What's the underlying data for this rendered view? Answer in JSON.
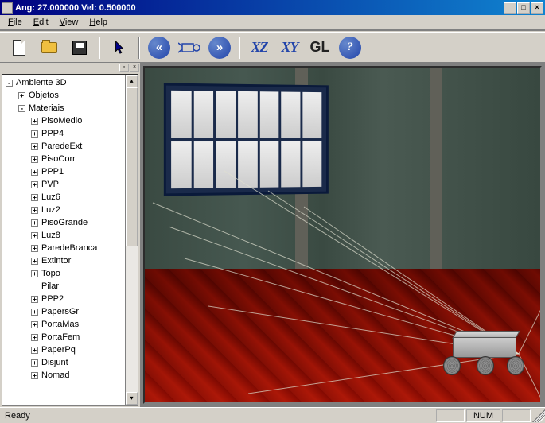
{
  "window": {
    "title": "Ang: 27.000000 Vel: 0.500000",
    "min": "_",
    "max": "□",
    "close": "×"
  },
  "menu": {
    "file": "File",
    "edit": "Edit",
    "view": "View",
    "help": "Help"
  },
  "toolbar": {
    "new": "new-file",
    "open": "open-file",
    "save": "save-file",
    "pointer": "pointer",
    "rewind": "«",
    "camera": "cam",
    "forward": "»",
    "xz": "XZ",
    "xy": "XY",
    "gl": "GL",
    "help": "?"
  },
  "tree": {
    "root": "Ambiente 3D",
    "objetos": "Objetos",
    "materiais": "Materiais",
    "items": [
      "PisoMedio",
      "PPP4",
      "ParedeExt",
      "PisoCorr",
      "PPP1",
      "PVP",
      "Luz6",
      "Luz2",
      "PisoGrande",
      "Luz8",
      "ParedeBranca",
      "Extintor",
      "Topo",
      "Pilar",
      "PPP2",
      "PapersGr",
      "PortaMas",
      "PortaFem",
      "PaperPq",
      "Disjunt",
      "Nomad"
    ]
  },
  "status": {
    "ready": "Ready",
    "num": "NUM"
  }
}
